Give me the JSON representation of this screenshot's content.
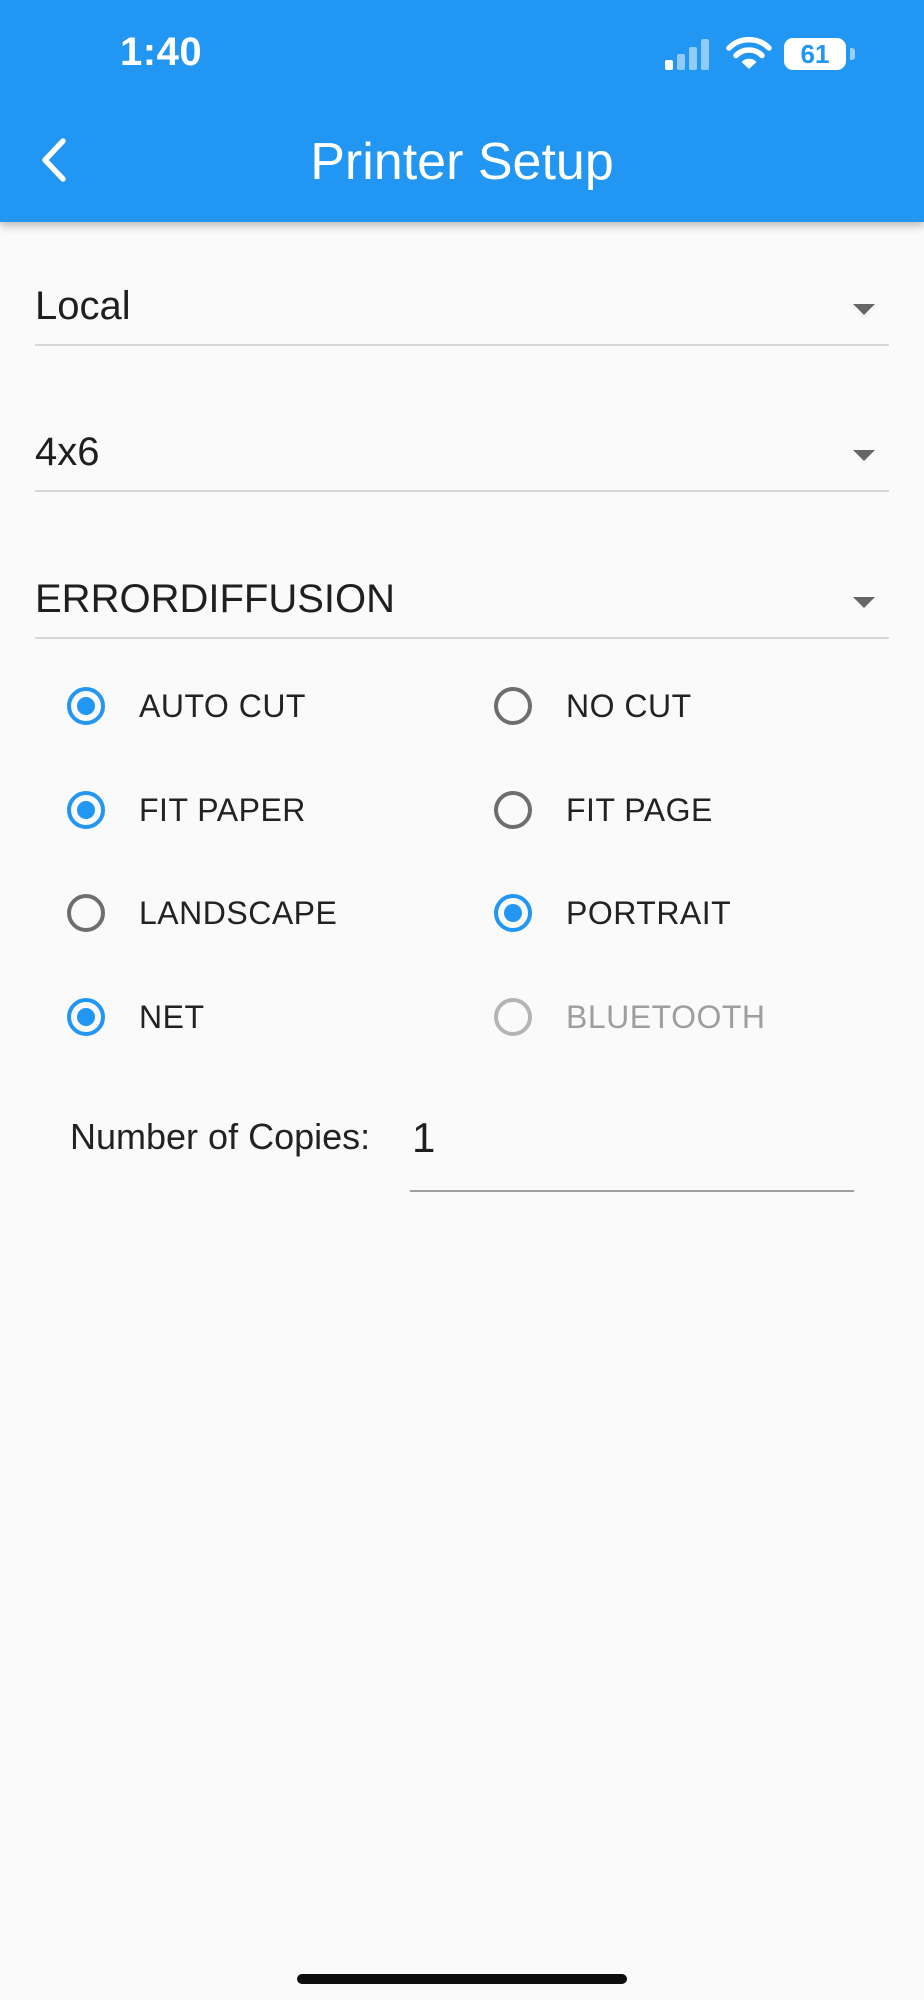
{
  "status_bar": {
    "time": "1:40",
    "battery": "61"
  },
  "header": {
    "title": "Printer Setup",
    "back_icon": "chevron-left-icon",
    "color": "#2196f3"
  },
  "dropdowns": {
    "printer": {
      "value": "Local"
    },
    "paper_size": {
      "value": "4x6"
    },
    "dithering": {
      "value": "ERRORDIFFUSION"
    }
  },
  "options": {
    "auto_cut": {
      "label": "AUTO CUT",
      "checked": true
    },
    "no_cut": {
      "label": "NO CUT",
      "checked": false
    },
    "fit_paper": {
      "label": "FIT PAPER",
      "checked": true
    },
    "fit_page": {
      "label": "FIT PAGE",
      "checked": false
    },
    "landscape": {
      "label": "LANDSCAPE",
      "checked": false
    },
    "portrait": {
      "label": "PORTRAIT",
      "checked": true
    },
    "net": {
      "label": "NET",
      "checked": true
    },
    "bluetooth": {
      "label": "BLUETOOTH",
      "checked": false,
      "disabled": true
    }
  },
  "copies": {
    "label": "Number of Copies:",
    "value": "1"
  },
  "colors": {
    "accent": "#2196f3",
    "background": "#fafafa"
  }
}
